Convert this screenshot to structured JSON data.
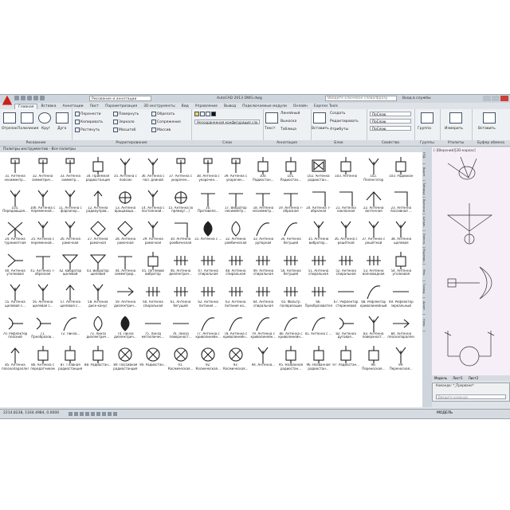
{
  "window": {
    "title": "AutoCAD 2013    DWG.dwg",
    "workspace": "Рисование и аннотации",
    "search_placeholder": "Введите ключевое слово/фразу",
    "signin": "Вход в службы"
  },
  "tabs": [
    "Главная",
    "Вставка",
    "Аннотации",
    "Лист",
    "Параметризация",
    "3D инструменты",
    "Вид",
    "Управление",
    "Вывод",
    "Подключаемые модули",
    "Онлайн",
    "Express Tools"
  ],
  "ribbon": {
    "draw": {
      "label": "Рисование",
      "buttons": [
        "Отрезок",
        "Полилиния",
        "Круг",
        "Дуга"
      ]
    },
    "modify": {
      "label": "Редактирование",
      "buttons": [
        "Перенести",
        "Копировать",
        "Растянуть",
        "Повернуть",
        "Зеркало",
        "Масштаб",
        "Обрезать",
        "Сопряжение",
        "Массив"
      ]
    },
    "layers": {
      "label": "Слои",
      "dropdown": "Несохраненная конфигурация сло"
    },
    "annotation": {
      "label": "Аннотация",
      "buttons": [
        "Текст",
        "Линейный",
        "Выноска",
        "Таблица"
      ]
    },
    "block": {
      "label": "Блок",
      "buttons": [
        "Вставить",
        "Создать",
        "Редактировать",
        "Атрибуты"
      ]
    },
    "properties": {
      "label": "Свойства",
      "values": [
        "ПоСлою",
        "ПоСлою",
        "ПоСлою"
      ]
    },
    "groups": {
      "label": "Группы",
      "button": "Группа"
    },
    "utilities": {
      "label": "Утилиты",
      "button": "Измерить"
    },
    "clipboard": {
      "label": "Буфер обмена",
      "button": "Вставить"
    }
  },
  "palette": {
    "title": "Палитры инструментов - Все палитры",
    "side_tabs": [
      "НТД",
      "Вырез",
      "Таблица",
      "Выноски",
      "Штрих.",
      "Электр.",
      "Моделир.",
      "Мех.",
      "Гражд.",
      "Архит.",
      "Напр."
    ],
    "items": [
      {
        "n": "31. Антенна несимметр...",
        "s": "flag"
      },
      {
        "n": "32. Антенна симметрич...",
        "s": "flag"
      },
      {
        "n": "33. Антенна симметр...",
        "s": "flag"
      },
      {
        "n": "34. Приемная радиостанция",
        "s": "box"
      },
      {
        "n": "35. Антенна с поясом",
        "s": "fork"
      },
      {
        "n": "36. Антенна с пол. длиной",
        "s": "fork"
      },
      {
        "n": "37. Антенна с укорочен...",
        "s": "flag"
      },
      {
        "n": "38. Антенна с укорочен...",
        "s": "flag"
      },
      {
        "n": "39. Антенна с укорочен...",
        "s": "flag"
      },
      {
        "n": "100. Радиостан...",
        "s": "box"
      },
      {
        "n": "101. Радиостан...",
        "s": "box"
      },
      {
        "n": "102. Антенна радиостан...",
        "s": "bowtie"
      },
      {
        "n": "103. Антенна",
        "s": "box"
      },
      {
        "n": "102. Пеленгатор",
        "s": "fork"
      },
      {
        "n": "103. Радиокан",
        "s": "box"
      },
      {
        "n": "105. Передающая...",
        "s": "fork"
      },
      {
        "n": "106. Антенна с переменной...",
        "s": "fork"
      },
      {
        "n": "11. Антенна с фарсинхр...",
        "s": "fork"
      },
      {
        "n": "12. Антенна радиоуправ...",
        "s": "arrowup"
      },
      {
        "n": "13. Антенна вращающа...",
        "s": "target"
      },
      {
        "n": "14. Антенна с постоянной...",
        "s": "fork"
      },
      {
        "n": "15. Антенна (в прямоуг...)",
        "s": "target"
      },
      {
        "n": "16. Противопо...",
        "s": "tee"
      },
      {
        "n": "17. Вибратор несимметр...",
        "s": "tee"
      },
      {
        "n": "18. Антенна несимметр...",
        "s": "tee"
      },
      {
        "n": "19. Антенна Т-образная",
        "s": "tee"
      },
      {
        "n": "20. Антенна Т-образная",
        "s": "corner"
      },
      {
        "n": "21. Антенна наклонная",
        "s": "corner"
      },
      {
        "n": "22. Антенна зонтичная",
        "s": "roof"
      },
      {
        "n": "23. Антенна пассивная ...",
        "s": "corner"
      },
      {
        "n": "24. Антенна турникетная",
        "s": "cross"
      },
      {
        "n": "25. Антенна с переменной...",
        "s": "fork"
      },
      {
        "n": "26. Антенна рамочная",
        "s": "fork"
      },
      {
        "n": "27. Антенна рамочная",
        "s": "diamond"
      },
      {
        "n": "28. Антенна рамочная",
        "s": "diamond"
      },
      {
        "n": "29. Антенна рамочная",
        "s": "fork"
      },
      {
        "n": "30. Антенна ромбическая",
        "s": "corner"
      },
      {
        "n": "31. Антенна с ...",
        "s": "lens"
      },
      {
        "n": "32. Антенна ромбическая",
        "s": "lens"
      },
      {
        "n": "33. Антенна рупорная",
        "s": "arc"
      },
      {
        "n": "34. Антенна бегущей",
        "s": "arc"
      },
      {
        "n": "35. Антенна вибратор...",
        "s": "fork"
      },
      {
        "n": "36. Антенна с решёткой",
        "s": "fork"
      },
      {
        "n": "37. Антенна с решёткой",
        "s": "fork"
      },
      {
        "n": "38. Антенна щелевая",
        "s": "fork"
      },
      {
        "n": "40. Антенна уголковая",
        "s": "vee"
      },
      {
        "n": "41. Антенна Т-образная",
        "s": "tee"
      },
      {
        "n": "42. Вибратор щелевой",
        "s": "funnel"
      },
      {
        "n": "43. Вибратор щелевой",
        "s": "funnel"
      },
      {
        "n": "44. Антенна симметрир...",
        "s": "tee"
      },
      {
        "n": "45. Петлевой вибратор",
        "s": "box"
      },
      {
        "n": "46. Антенна диэлектрич...",
        "s": "comb"
      },
      {
        "n": "47. Антенна спиральная",
        "s": "comb"
      },
      {
        "n": "48. Антенна спиральная",
        "s": "comb"
      },
      {
        "n": "49. Антенна спиральная",
        "s": "comb"
      },
      {
        "n": "50. Антенна бегущей",
        "s": "comb"
      },
      {
        "n": "51. Антенна спиральная",
        "s": "comb"
      },
      {
        "n": "52. Антенна спиральная",
        "s": "comb"
      },
      {
        "n": "53. Антенна волноводная",
        "s": "comb"
      },
      {
        "n": "54. Антенна уголковая",
        "s": "box"
      },
      {
        "n": "55. Антенна щелевая с...",
        "s": "fork"
      },
      {
        "n": "56. Антенна щелевая с...",
        "s": "fork"
      },
      {
        "n": "57. Антенна щелевая с...",
        "s": "arrowup"
      },
      {
        "n": "58. Антенна диск-конус",
        "s": "fork"
      },
      {
        "n": "59. Антенна диэлектрич...",
        "s": "arrowright"
      },
      {
        "n": "60. Антенна спиральная",
        "s": "comb"
      },
      {
        "n": "61. Антенна бегущей",
        "s": "comb"
      },
      {
        "n": "62. Антенна питания ...",
        "s": "comb"
      },
      {
        "n": "63. Антенна питания на...",
        "s": "comb"
      },
      {
        "n": "64. Антенна спиральная",
        "s": "comb"
      },
      {
        "n": "65. Фильтр поляризации",
        "s": "comb"
      },
      {
        "n": "66. Преобразователь",
        "s": "comb"
      },
      {
        "n": "67. Рефлектор стержневой",
        "s": "hline"
      },
      {
        "n": "68. Рефлектор криволинейный",
        "s": "arc"
      },
      {
        "n": "69. Рефлектор зеркальный",
        "s": "hline"
      },
      {
        "n": "70. Рефлектор плоский",
        "s": "dish"
      },
      {
        "n": "71. Преобразов...",
        "s": "dish"
      },
      {
        "n": "72. Линза...",
        "s": "arc"
      },
      {
        "n": "73. Линза диэлектрич...",
        "s": "lens"
      },
      {
        "n": "74. Линза диэлектрич...",
        "s": "lens"
      },
      {
        "n": "75. Линза металличес...",
        "s": "hline"
      },
      {
        "n": "76. Линза поверхност...",
        "s": "hline"
      },
      {
        "n": "77. Антенна с криволинейн...",
        "s": "arc"
      },
      {
        "n": "78. Антенна с криволинейн...",
        "s": "arc"
      },
      {
        "n": "79. Антенна с криволинейн...",
        "s": "arc"
      },
      {
        "n": "80. Антенна с криволинейн...",
        "s": "arc"
      },
      {
        "n": "81. Антенна с ...",
        "s": "arc"
      },
      {
        "n": "82. Антенна дуговая...",
        "s": "dish"
      },
      {
        "n": "83. Антенна поверхност...",
        "s": "fork"
      },
      {
        "n": "84. Антенна плоскопараллельна",
        "s": "arrowright"
      },
      {
        "n": "85. Антенна плоскопараллельна",
        "s": "arrowup"
      },
      {
        "n": "86. Антенна с передатчиком",
        "s": "box"
      },
      {
        "n": "87. Главная радиостанция",
        "s": "box"
      },
      {
        "n": "88. Радиостан...",
        "s": "box"
      },
      {
        "n": "89. Пассивная радиостанция",
        "s": "circle"
      },
      {
        "n": "90. Радиостан...",
        "s": "circle"
      },
      {
        "n": "91. Космическая...",
        "s": "circle"
      },
      {
        "n": "92. Космическая...",
        "s": "circle"
      },
      {
        "n": "93. Космическая...",
        "s": "circle"
      },
      {
        "n": "94. Антенна...",
        "s": "fork"
      },
      {
        "n": "95. Названная радиостан...",
        "s": "box"
      },
      {
        "n": "96. Названная радиостан...",
        "s": "box"
      },
      {
        "n": "97. Радиостан...",
        "s": "box"
      },
      {
        "n": "98. Переносная...",
        "s": "box"
      },
      {
        "n": "99. Переносная...",
        "s": "fork"
      }
    ]
  },
  "viewport": {
    "label": "[-][Верхний][2D-каркас]",
    "tabs": [
      "Модель",
      "Лист1",
      "Лист2"
    ]
  },
  "command": {
    "history": "Команда: *_Прервано*",
    "prompt": "Введите команду"
  },
  "status": {
    "coords": "2214.8238, 1164.4984, 0.0000",
    "space": "МОДЕЛЬ"
  },
  "colors": {
    "accent": "#c9201b",
    "ribbon": "#eef1f4",
    "viewport": "#f7eff8"
  }
}
